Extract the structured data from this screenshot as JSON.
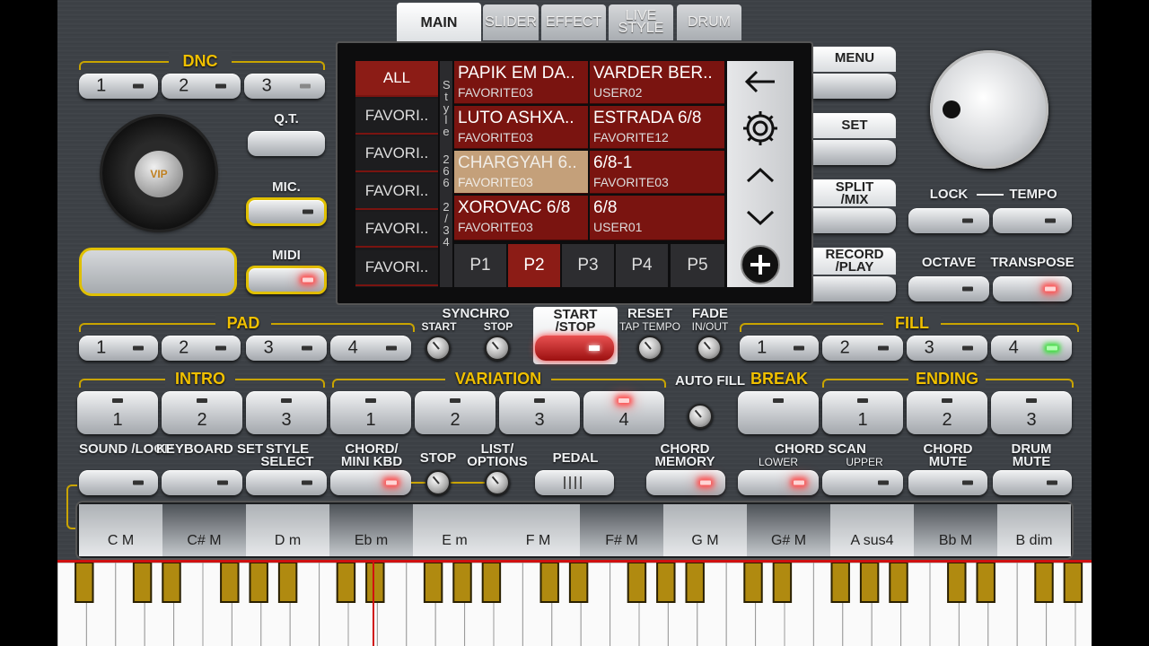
{
  "tabs": [
    {
      "label": "MAIN"
    },
    {
      "label": "SLIDER"
    },
    {
      "label": "EFFECT"
    },
    {
      "label": "LIVE STYLE"
    },
    {
      "label": "DRUM"
    }
  ],
  "dnc": {
    "title": "DNC",
    "buttons": [
      "1",
      "2",
      "3"
    ]
  },
  "qt_label": "Q.T.",
  "mic_label": "MIC.",
  "midi_label": "MIDI",
  "logo_text": "VIP",
  "style_browser": {
    "categories": [
      "ALL",
      "FAVORI..",
      "FAVORI..",
      "FAVORI..",
      "FAVORI..",
      "FAVORI.."
    ],
    "side_label": "Style",
    "count": "266",
    "meter": "2/34",
    "styles": [
      {
        "name": "PAPIK EM DA..",
        "cat": "FAVORITE03"
      },
      {
        "name": "VARDER BER..",
        "cat": "USER02"
      },
      {
        "name": "LUTO ASHXA..",
        "cat": "FAVORITE03"
      },
      {
        "name": "ESTRADA 6/8",
        "cat": "FAVORITE12"
      },
      {
        "name": "CHARGYAH 6..",
        "cat": "FAVORITE03"
      },
      {
        "name": "6/8-1",
        "cat": "FAVORITE03"
      },
      {
        "name": "XOROVAC 6/8",
        "cat": "FAVORITE03"
      },
      {
        "name": "6/8",
        "cat": "USER01"
      }
    ],
    "pages": [
      "P1",
      "P2",
      "P3",
      "P4",
      "P5"
    ]
  },
  "right_menu": {
    "menu": "MENU",
    "set": "SET",
    "split": "SPLIT /MIX",
    "record": "RECORD /PLAY"
  },
  "lock_label": "LOCK",
  "tempo_label": "TEMPO",
  "octave_label": "OCTAVE",
  "transpose_label": "TRANSPOSE",
  "pad": {
    "title": "PAD",
    "buttons": [
      "1",
      "2",
      "3",
      "4"
    ]
  },
  "synchro": {
    "title": "SYNCHRO",
    "start": "START",
    "stop": "STOP"
  },
  "start_stop": "START /STOP",
  "reset": {
    "title": "RESET",
    "sub": "TAP TEMPO"
  },
  "fade": {
    "title": "FADE",
    "sub": "IN/OUT"
  },
  "fill": {
    "title": "FILL",
    "buttons": [
      "1",
      "2",
      "3",
      "4"
    ]
  },
  "intro": {
    "title": "INTRO",
    "buttons": [
      "1",
      "2",
      "3"
    ]
  },
  "variation": {
    "title": "VARIATION",
    "buttons": [
      "1",
      "2",
      "3",
      "4"
    ]
  },
  "auto_fill": "AUTO FILL",
  "break_label": "BREAK",
  "ending": {
    "title": "ENDING",
    "buttons": [
      "1",
      "2",
      "3"
    ]
  },
  "bottom_labels": {
    "sound_loop": "SOUND /LOOP",
    "keyboard_set": "KEYBOARD SET",
    "style_select": "STYLE SELECT",
    "chord_mini": "CHORD/ MINI KBD",
    "stop": "STOP",
    "list_options": "LIST/ OPTIONS",
    "pedal": "PEDAL",
    "chord_memory": "CHORD MEMORY",
    "chord_scan": "CHORD SCAN",
    "lower": "LOWER",
    "upper": "UPPER",
    "chord_mute": "CHORD MUTE",
    "drum_mute": "DRUM MUTE"
  },
  "chords": [
    "C M",
    "C# M",
    "D m",
    "Eb m",
    "E m",
    "F M",
    "F# M",
    "G M",
    "G# M",
    "A sus4",
    "Bb M",
    "B dim"
  ],
  "colors": {
    "accent_gold": "#c9a400",
    "style_red": "#7a1410",
    "selected_style": "#c4a07a",
    "led_red": "#ff5050",
    "led_green": "#30e030"
  }
}
